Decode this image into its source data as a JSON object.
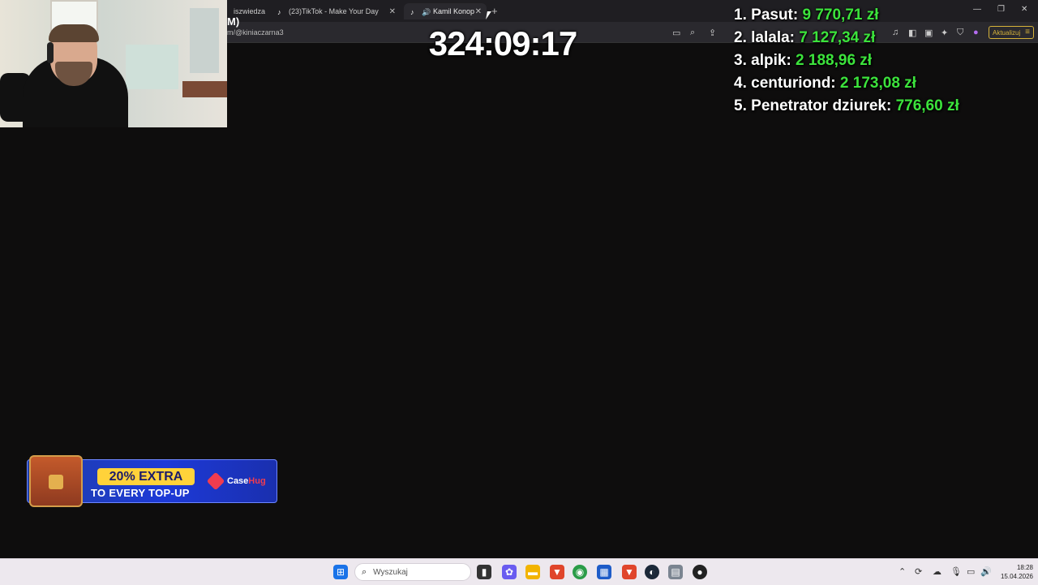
{
  "browser": {
    "tabs": [
      {
        "label": "iszwiedza",
        "active": false
      },
      {
        "label": "(23)TikTok - Make Your Day",
        "active": false
      },
      {
        "label": "Kamil Konop",
        "active": true
      }
    ],
    "page_fragment": "M)",
    "url": "m/@kiniaczarna3",
    "update_button": "Aktualizuj"
  },
  "overlay": {
    "timer": "324:09:17",
    "leaderboard": [
      {
        "rank": "1.",
        "name": "Pasut:",
        "amount": "9 770,71 zł"
      },
      {
        "rank": "2.",
        "name": "lalala:",
        "amount": "7 127,34 zł"
      },
      {
        "rank": "3.",
        "name": "alpik:",
        "amount": "2 188,96 zł"
      },
      {
        "rank": "4.",
        "name": "centuriond:",
        "amount": "2 173,08 zł"
      },
      {
        "rank": "5.",
        "name": "Penetrator dziurek:",
        "amount": "776,60 zł"
      }
    ]
  },
  "ad": {
    "badge": "20% EXTRA",
    "subtitle": "TO EVERY TOP-UP",
    "brand_case": "Case",
    "brand_hug": "Hug"
  },
  "taskbar": {
    "search_placeholder": "Wyszukaj",
    "time": "18:28",
    "date": "15.04.2026"
  }
}
